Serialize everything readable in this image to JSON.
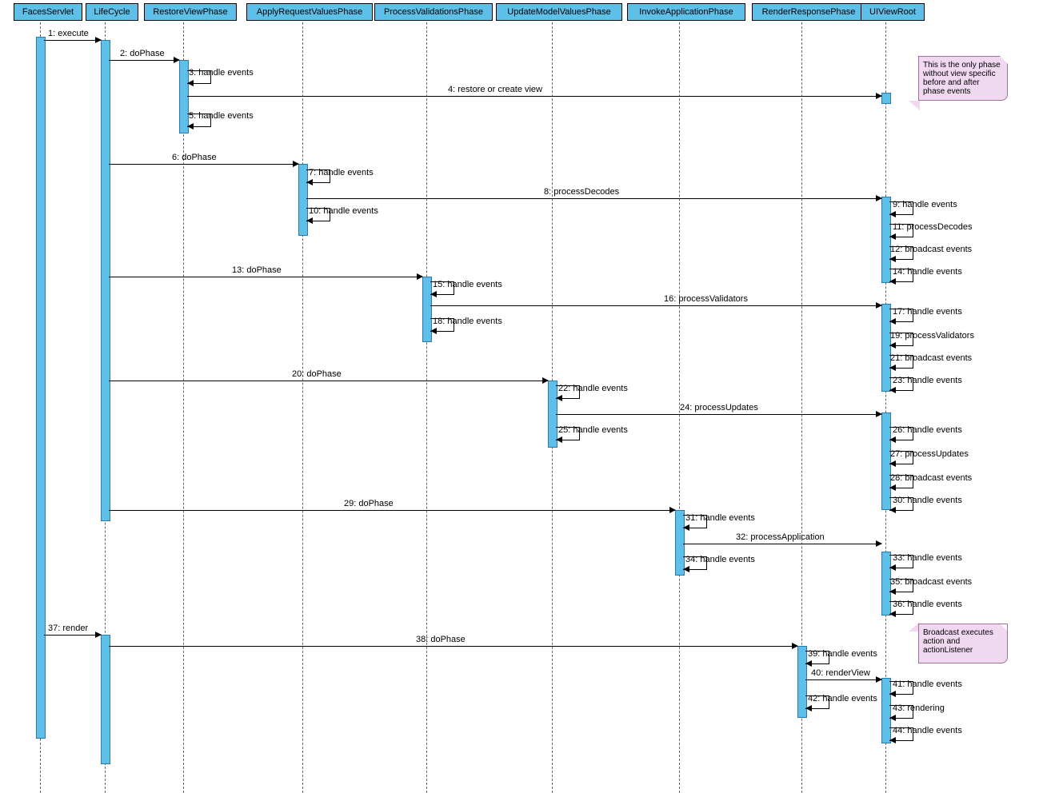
{
  "lifelines": {
    "facesServlet": "FacesServlet",
    "lifeCycle": "LifeCycle",
    "restoreView": "RestoreViewPhase",
    "applyRequest": "ApplyRequestValuesPhase",
    "processValidations": "ProcessValidationsPhase",
    "updateModel": "UpdateModelValuesPhase",
    "invokeApp": "InvokeApplicationPhase",
    "renderResponse": "RenderResponsePhase",
    "uiViewRoot": "UIViewRoot"
  },
  "messages": {
    "m1": "1: execute",
    "m2": "2: doPhase",
    "m3": "3: handle events",
    "m4": "4: restore or create view",
    "m5": "5: handle events",
    "m6": "6: doPhase",
    "m7": "7: handle events",
    "m8": "8: processDecodes",
    "m9": "9: handle events",
    "m10": "10: handle events",
    "m11": "11: processDecodes",
    "m12": "12: broadcast events",
    "m13": "13: doPhase",
    "m14": "14: handle events",
    "m15": "15: handle events",
    "m16": "16: processValidators",
    "m17": "17: handle events",
    "m18": "18: handle events",
    "m19": "19: processValidators",
    "m20": "20: doPhase",
    "m21": "21: broadcast events",
    "m22": "22: handle events",
    "m23": "23: handle events",
    "m24": "24: processUpdates",
    "m25": "25: handle events",
    "m26": "26: handle events",
    "m27": "27: processUpdates",
    "m28": "28: broadcast events",
    "m29": "29: doPhase",
    "m30": "30: handle events",
    "m31": "31: handle events",
    "m32": "32: processApplication",
    "m33": "33: handle events",
    "m34": "34: handle events",
    "m35": "35: broadcast events",
    "m36": "36: handle events",
    "m37": "37: render",
    "m38": "38: doPhase",
    "m39": "39: handle events",
    "m40": "40: renderView",
    "m41": "41: handle events",
    "m42": "42: handle events",
    "m43": "43: rendering",
    "m44": "44: handle events"
  },
  "notes": {
    "note1": "This is the only phase without view specific before and after phase events",
    "note2": "Broadcast executes action and actionListener"
  }
}
